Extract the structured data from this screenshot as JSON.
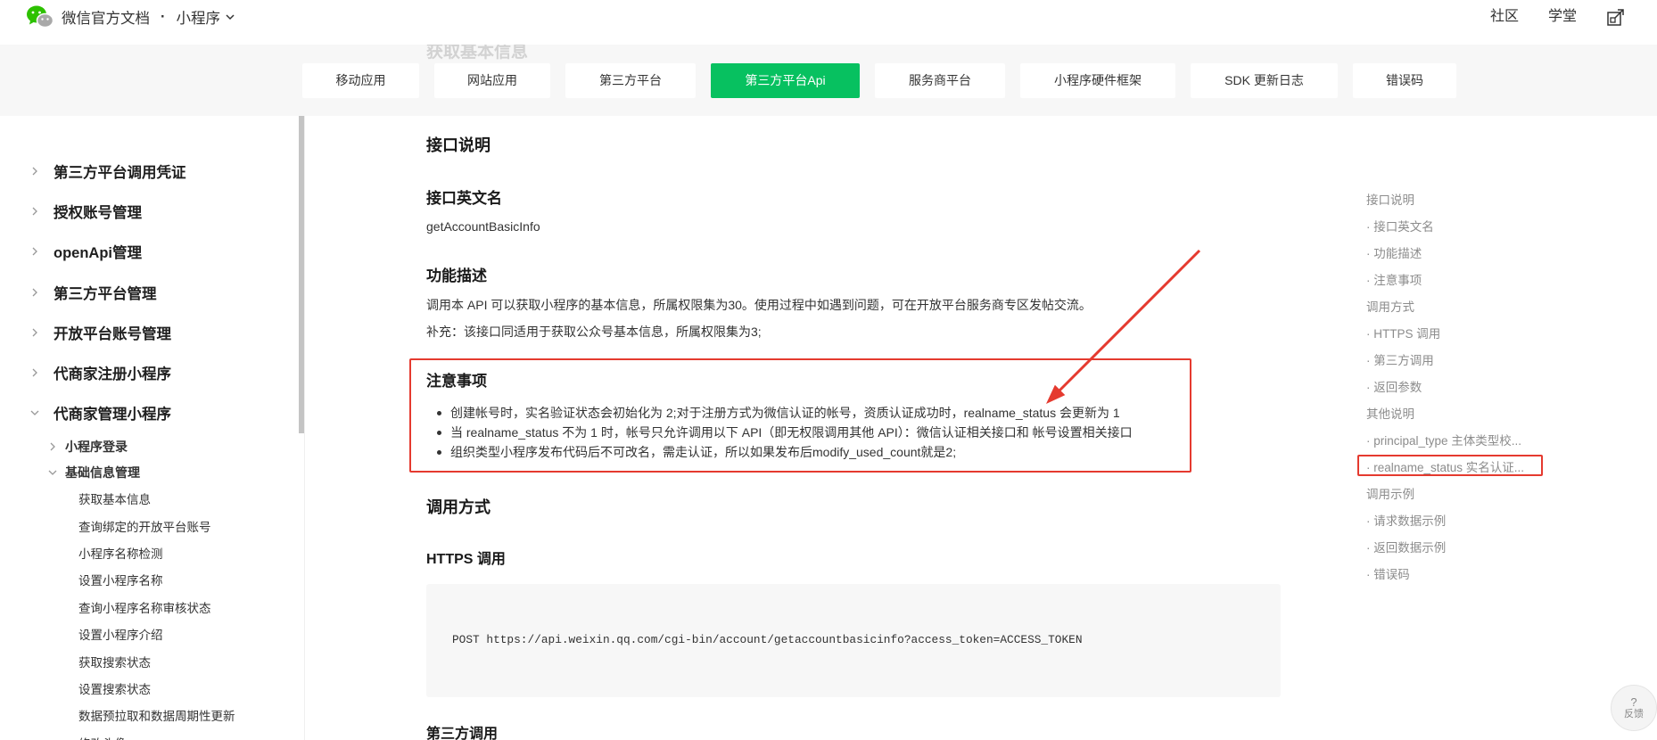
{
  "header": {
    "brand": "微信官方文档",
    "separator": "·",
    "section": "小程序",
    "community": "社区",
    "academy": "学堂",
    "logo_icon": "wechat-logo-icon",
    "right_icon": "external-window-icon"
  },
  "page": {
    "ghost_title": "获取基本信息"
  },
  "nav": {
    "tabs": [
      {
        "label": "移动应用",
        "active": false
      },
      {
        "label": "网站应用",
        "active": false
      },
      {
        "label": "第三方平台",
        "active": false
      },
      {
        "label": "第三方平台Api",
        "active": true
      },
      {
        "label": "服务商平台",
        "active": false
      },
      {
        "label": "小程序硬件框架",
        "active": false
      },
      {
        "label": "SDK 更新日志",
        "active": false
      },
      {
        "label": "错误码",
        "active": false
      }
    ]
  },
  "sidebar": {
    "groups": [
      {
        "label": "第三方平台调用凭证",
        "expanded": false
      },
      {
        "label": "授权账号管理",
        "expanded": false
      },
      {
        "label": "openApi管理",
        "expanded": false
      },
      {
        "label": "第三方平台管理",
        "expanded": false
      },
      {
        "label": "开放平台账号管理",
        "expanded": false
      },
      {
        "label": "代商家注册小程序",
        "expanded": false
      },
      {
        "label": "代商家管理小程序",
        "expanded": true
      }
    ],
    "subgroups": [
      {
        "label": "小程序登录",
        "expanded": false
      },
      {
        "label": "基础信息管理",
        "expanded": true
      }
    ],
    "items": [
      {
        "label": "获取基本信息"
      },
      {
        "label": "查询绑定的开放平台账号"
      },
      {
        "label": "小程序名称检测"
      },
      {
        "label": "设置小程序名称"
      },
      {
        "label": "查询小程序名称审核状态"
      },
      {
        "label": "设置小程序介绍"
      },
      {
        "label": "获取搜索状态"
      },
      {
        "label": "设置搜索状态"
      },
      {
        "label": "数据预拉取和数据周期性更新"
      },
      {
        "label": "修改头像"
      }
    ]
  },
  "content": {
    "h_interface": "接口说明",
    "h_english_name": "接口英文名",
    "english_name": "getAccountBasicInfo",
    "h_function": "功能描述",
    "function_desc": "调用本 API 可以获取小程序的基本信息，所属权限集为30。使用过程中如遇到问题，可在开放平台服务商专区发帖交流。",
    "function_supplement": "补充：该接口同适用于获取公众号基本信息，所属权限集为3;",
    "h_notes": "注意事项",
    "notes": [
      "创建帐号时，实名验证状态会初始化为 2;对于注册方式为微信认证的帐号，资质认证成功时，realname_status 会更新为 1",
      "当 realname_status 不为 1 时，帐号只允许调用以下 API（即无权限调用其他 API）：微信认证相关接口和 帐号设置相关接口",
      "组织类型小程序发布代码后不可改名，需走认证，所以如果发布后modify_used_count就是2;"
    ],
    "h_call": "调用方式",
    "h_https": "HTTPS 调用",
    "https_code": "POST https://api.weixin.qq.com/cgi-bin/account/getaccountbasicinfo?access_token=ACCESS_TOKEN",
    "h_third_party": "第三方调用"
  },
  "toc": {
    "items": [
      {
        "label": "接口说明",
        "level": 1
      },
      {
        "label": "接口英文名",
        "level": 2
      },
      {
        "label": "功能描述",
        "level": 2
      },
      {
        "label": "注意事项",
        "level": 2
      },
      {
        "label": "调用方式",
        "level": 1
      },
      {
        "label": "HTTPS 调用",
        "level": 2
      },
      {
        "label": "第三方调用",
        "level": 2
      },
      {
        "label": "返回参数",
        "level": 2
      },
      {
        "label": "其他说明",
        "level": 1
      },
      {
        "label": "principal_type 主体类型校...",
        "level": 2
      },
      {
        "label": "realname_status 实名认证...",
        "level": 2,
        "annotated": true
      },
      {
        "label": "调用示例",
        "level": 1
      },
      {
        "label": "请求数据示例",
        "level": 2
      },
      {
        "label": "返回数据示例",
        "level": 2
      },
      {
        "label": "错误码",
        "level": 2
      }
    ]
  },
  "feedback": {
    "icon": "?",
    "label": "反馈"
  },
  "colors": {
    "accent": "#07c160",
    "annotation": "#e53a2f",
    "nav_background": "#f7f7f7",
    "code_background": "#f7f7f7"
  }
}
